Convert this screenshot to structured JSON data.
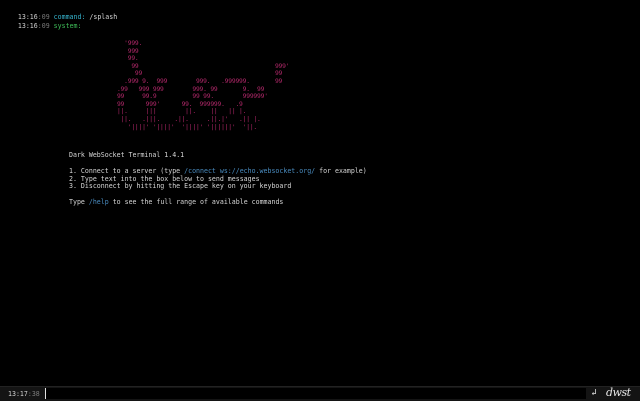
{
  "log": [
    {
      "time_hm": "13:16",
      "time_s": ":09",
      "label": "command:",
      "text": " /splash"
    },
    {
      "time_hm": "13:16",
      "time_s": ":09",
      "label": "system:",
      "text": ""
    }
  ],
  "splash": {
    "title": "Dark WebSocket Terminal",
    "version": "1.4.1",
    "steps": [
      {
        "before": "1. Connect to a server (type ",
        "cmd": "/connect ws://echo.websocket.org/",
        "after": " for example)"
      },
      {
        "before": "2. Type text into the box below to send messages",
        "cmd": "",
        "after": ""
      },
      {
        "before": "3. Disconnect by hitting the Escape key on your keyboard",
        "cmd": "",
        "after": ""
      }
    ],
    "help": {
      "before": "Type ",
      "cmd": "/help",
      "after": " to see the full range of available commands"
    }
  },
  "input_bar": {
    "time_hm": "13:17",
    "time_s": ":38",
    "value": "",
    "send_icon": "enter-return-icon",
    "logo_text": "dwst"
  },
  "colors": {
    "background": "#000000",
    "command_label": "#35b3cc",
    "system_label": "#3fbf59",
    "art": "#b2286a",
    "link": "#4a8cc0"
  }
}
